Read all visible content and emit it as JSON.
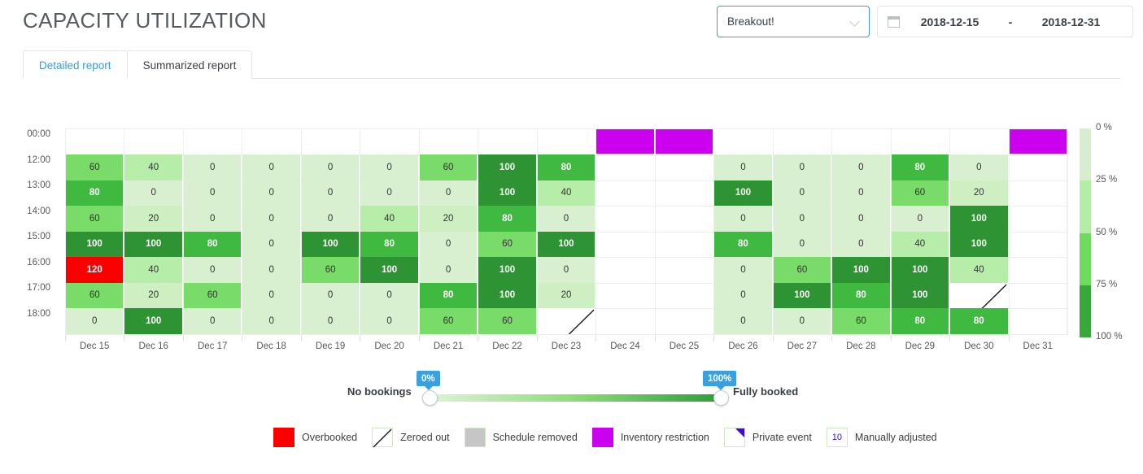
{
  "header": {
    "title": "CAPACITY UTILIZATION",
    "resource_select": {
      "value": "Breakout!",
      "icon": "chevron-down-icon"
    },
    "date_range": {
      "icon": "calendar-icon",
      "start": "2018-12-15",
      "separator": "-",
      "end": "2018-12-31"
    }
  },
  "tabs": [
    {
      "label": "Detailed report",
      "active": true
    },
    {
      "label": "Summarized report",
      "active": false
    }
  ],
  "chart_data": {
    "type": "heatmap",
    "title": "CAPACITY UTILIZATION",
    "xlabel": "",
    "ylabel": "",
    "categories": [
      "Dec 15",
      "Dec 16",
      "Dec 17",
      "Dec 18",
      "Dec 19",
      "Dec 20",
      "Dec 21",
      "Dec 22",
      "Dec 23",
      "Dec 24",
      "Dec 25",
      "Dec 26",
      "Dec 27",
      "Dec 28",
      "Dec 29",
      "Dec 30",
      "Dec 31"
    ],
    "rows": [
      "00:00",
      "12:00",
      "13:00",
      "14:00",
      "15:00",
      "16:00",
      "17:00",
      "18:00"
    ],
    "zlim": [
      0,
      100
    ],
    "zunit": "%",
    "values": [
      [
        null,
        null,
        null,
        null,
        null,
        null,
        null,
        null,
        null,
        "inventory",
        "inventory",
        null,
        null,
        null,
        null,
        null,
        "inventory"
      ],
      [
        60,
        40,
        0,
        0,
        0,
        0,
        60,
        100,
        80,
        null,
        null,
        0,
        0,
        0,
        80,
        0,
        null
      ],
      [
        80,
        0,
        0,
        0,
        0,
        0,
        0,
        100,
        40,
        null,
        null,
        100,
        0,
        0,
        60,
        20,
        null
      ],
      [
        60,
        20,
        0,
        0,
        0,
        40,
        20,
        80,
        0,
        null,
        null,
        0,
        0,
        0,
        0,
        100,
        null
      ],
      [
        100,
        100,
        80,
        0,
        100,
        80,
        0,
        60,
        100,
        null,
        null,
        80,
        0,
        0,
        40,
        100,
        null
      ],
      [
        120,
        40,
        0,
        0,
        60,
        100,
        0,
        100,
        0,
        null,
        null,
        0,
        60,
        100,
        100,
        40,
        null
      ],
      [
        60,
        20,
        60,
        0,
        0,
        0,
        80,
        100,
        20,
        null,
        null,
        0,
        100,
        80,
        100,
        "zeroed",
        null
      ],
      [
        0,
        100,
        0,
        0,
        0,
        0,
        60,
        60,
        "zeroed",
        null,
        null,
        0,
        0,
        60,
        80,
        80,
        null
      ]
    ],
    "colorbar": {
      "ticks": [
        "0 %",
        "25 %",
        "50 %",
        "75 %",
        "100 %"
      ],
      "colors": [
        "#d6eecd",
        "#b4eda6",
        "#6ddb5b",
        "#37a93a"
      ]
    },
    "special_colors": {
      "overbooked": "#fb0000",
      "inventory_restriction": "#cc00ee",
      "schedule_removed": "#c6c6c6",
      "private_event": "#3b0ce0"
    }
  },
  "slider": {
    "left_label": "No bookings",
    "right_label": "Fully booked",
    "min_bubble": "0%",
    "max_bubble": "100%",
    "min_value": 0,
    "max_value": 100
  },
  "legend": [
    {
      "key": "overbooked",
      "label": "Overbooked",
      "icon": "red-square-icon"
    },
    {
      "key": "zeroed",
      "label": "Zeroed out",
      "icon": "diagonal-line-icon"
    },
    {
      "key": "removed",
      "label": "Schedule removed",
      "icon": "gray-square-icon"
    },
    {
      "key": "inventory",
      "label": "Inventory restriction",
      "icon": "magenta-square-icon"
    },
    {
      "key": "private",
      "label": "Private event",
      "icon": "corner-triangle-icon"
    },
    {
      "key": "manual",
      "label": "Manually adjusted",
      "icon": "number-badge-icon",
      "badge": "10"
    }
  ]
}
